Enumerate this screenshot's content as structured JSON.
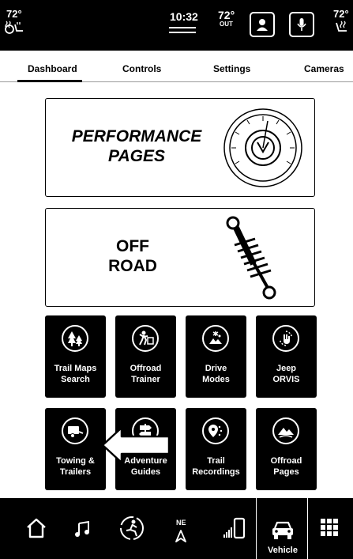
{
  "status": {
    "cabin_temp_left": "72°",
    "time": "10:32",
    "outside_temp": "72°",
    "outside_label": "OUT",
    "cabin_temp_right": "72°"
  },
  "tabs": [
    {
      "label": "Dashboard",
      "active": true
    },
    {
      "label": "Controls",
      "active": false
    },
    {
      "label": "Settings",
      "active": false
    },
    {
      "label": "Cameras",
      "active": false
    }
  ],
  "cards": {
    "performance": {
      "line1": "PERFORMANCE",
      "line2": "PAGES",
      "icon": "gauge-icon"
    },
    "offroad": {
      "line1": "OFF",
      "line2": "ROAD",
      "icon": "shock-absorber-icon"
    }
  },
  "tiles": [
    {
      "line1": "Trail Maps",
      "line2": "Search",
      "icon": "trees-icon"
    },
    {
      "line1": "Offroad",
      "line2": "Trainer",
      "icon": "trainer-icon"
    },
    {
      "line1": "Drive",
      "line2": "Modes",
      "icon": "drive-modes-icon"
    },
    {
      "line1": "Jeep",
      "line2": "ORVIS",
      "icon": "orvis-icon"
    },
    {
      "line1": "Towing &",
      "line2": "Trailers",
      "icon": "trailer-icon"
    },
    {
      "line1": "Adventure",
      "line2": "Guides",
      "icon": "signpost-icon"
    },
    {
      "line1": "Trail",
      "line2": "Recordings",
      "icon": "trail-pin-icon"
    },
    {
      "line1": "Offroad",
      "line2": "Pages",
      "icon": "mountain-icon"
    }
  ],
  "nav": {
    "compass": "NE",
    "vehicle_label": "Vehicle"
  },
  "colors": {
    "background": "#ffffff",
    "bar": "#000000",
    "text": "#000000"
  }
}
